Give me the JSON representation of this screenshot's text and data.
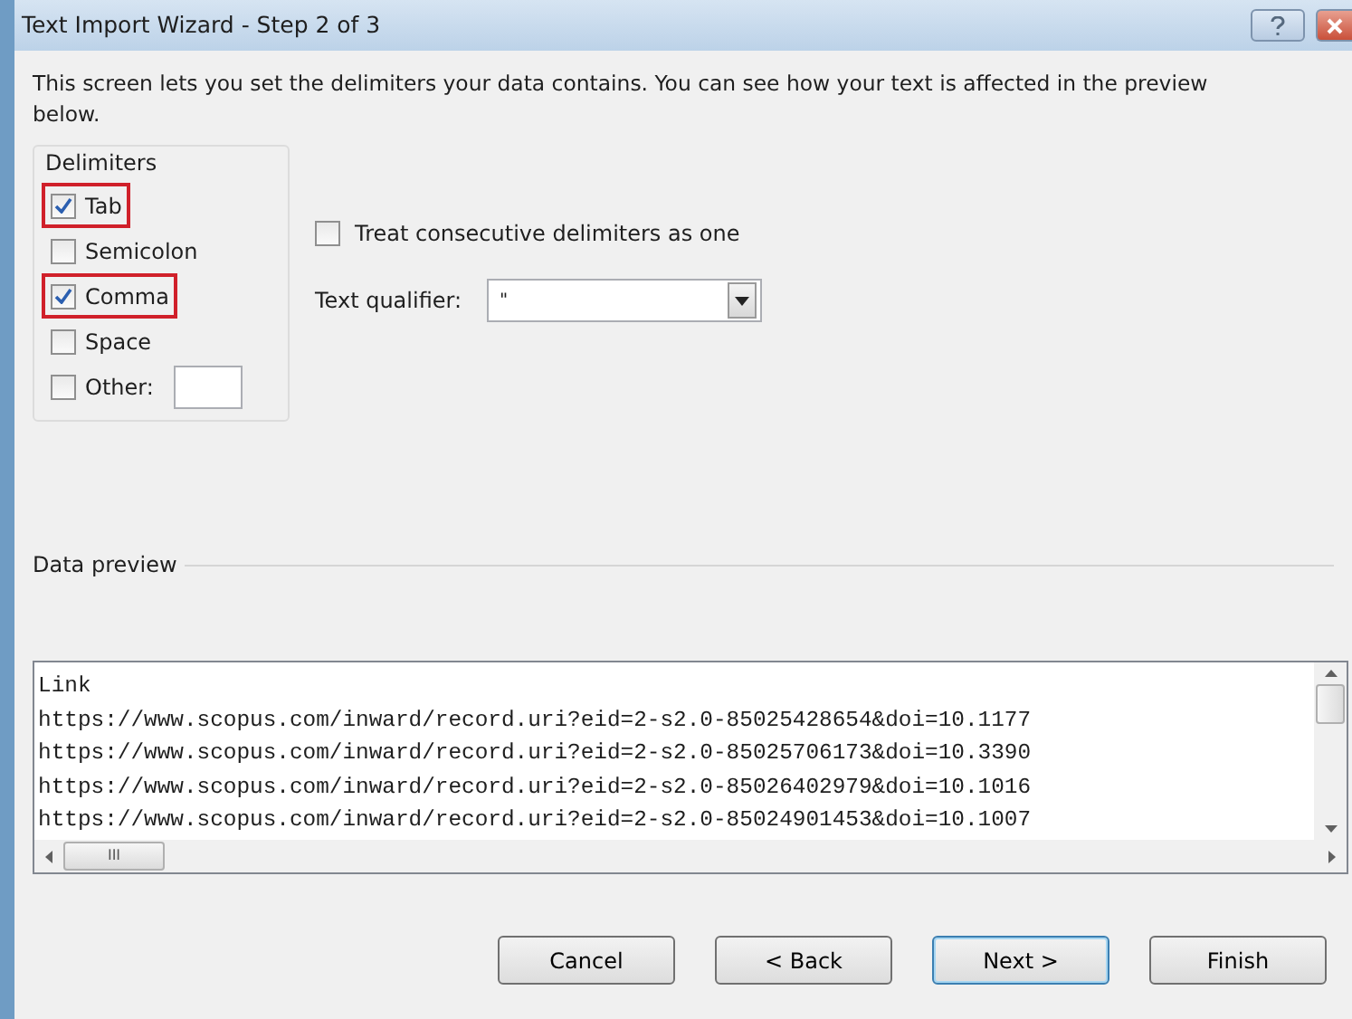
{
  "window": {
    "title": "Text Import Wizard - Step 2 of 3"
  },
  "intro": "This screen lets you set the delimiters your data contains.  You can see how your text is affected in the preview below.",
  "delimiters": {
    "title": "Delimiters",
    "items": [
      {
        "label": "Tab",
        "checked": true,
        "highlighted": true
      },
      {
        "label": "Semicolon",
        "checked": false,
        "highlighted": false
      },
      {
        "label": "Comma",
        "checked": true,
        "highlighted": true
      },
      {
        "label": "Space",
        "checked": false,
        "highlighted": false
      },
      {
        "label": "Other:",
        "checked": false,
        "highlighted": false,
        "kind": "with-field"
      }
    ]
  },
  "treat_consecutive": {
    "label": "Treat consecutive delimiters as one",
    "checked": false
  },
  "text_qualifier": {
    "label": "Text qualifier:",
    "value": "\""
  },
  "data_preview": {
    "title": "Data preview",
    "lines": [
      "Link",
      "https://www.scopus.com/inward/record.uri?eid=2-s2.0-85025428654&doi=10.1177",
      "https://www.scopus.com/inward/record.uri?eid=2-s2.0-85025706173&doi=10.3390",
      "https://www.scopus.com/inward/record.uri?eid=2-s2.0-85026402979&doi=10.1016",
      "https://www.scopus.com/inward/record.uri?eid=2-s2.0-85024901453&doi=10.1007"
    ],
    "hscroll_grip": "III"
  },
  "buttons": [
    {
      "label": "Cancel",
      "default": false
    },
    {
      "label": "< Back",
      "default": false
    },
    {
      "label": "Next >",
      "default": true
    },
    {
      "label": "Finish",
      "default": false
    }
  ]
}
